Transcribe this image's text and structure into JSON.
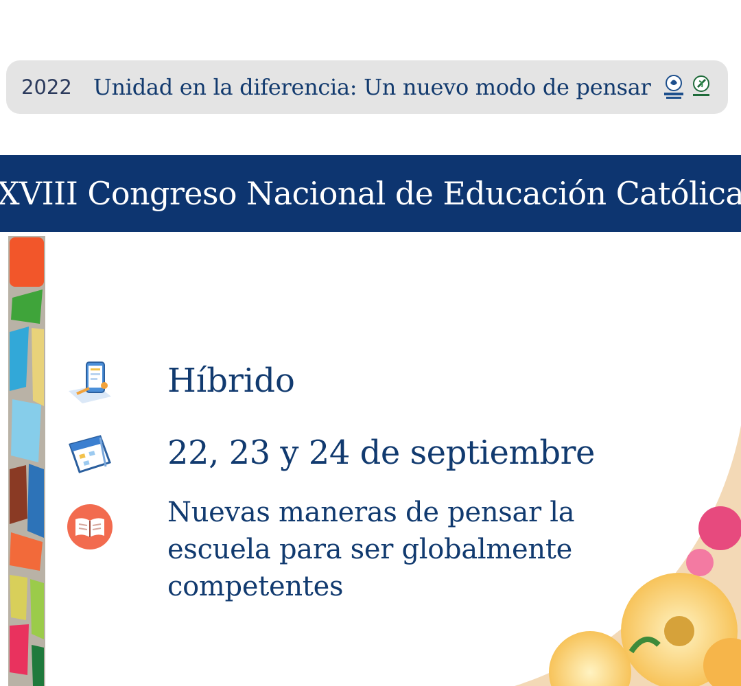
{
  "header": {
    "year": "2022",
    "motto": "Unidad en la diferencia: Un nuevo modo de pensar"
  },
  "banner": {
    "title": "XVIII Congreso Nacional de Educación Católica"
  },
  "details": [
    {
      "icon": "mobile-form-icon",
      "text": "Híbrido"
    },
    {
      "icon": "calendar-icon",
      "text": "22, 23 y 24 de septiembre"
    },
    {
      "icon": "open-book-icon",
      "lines": [
        "Nuevas maneras de pensar la",
        "escuela para ser globalmente",
        "competentes"
      ]
    }
  ],
  "colors": {
    "brand_navy": "#0d3570",
    "text_navy": "#113a6f",
    "header_bg": "#e4e4e4",
    "book_badge": "#f26b4f"
  }
}
